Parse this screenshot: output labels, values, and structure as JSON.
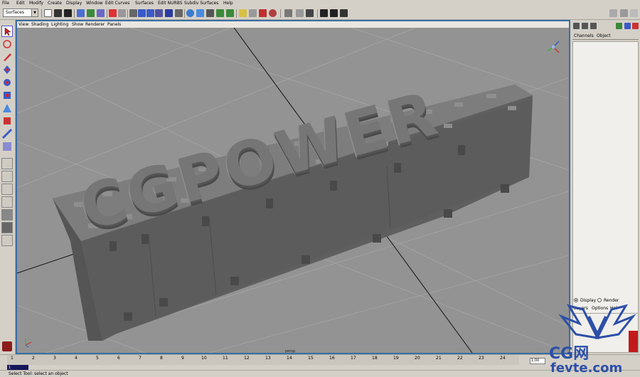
{
  "menu": [
    "File",
    "Edit",
    "Modify",
    "Create",
    "Display",
    "Window",
    "Edit Curves",
    "Surfaces",
    "Edit NURBS",
    "Subdiv Surfaces",
    "Help"
  ],
  "toolbar": {
    "mode": "Surfaces"
  },
  "viewport": {
    "menu": [
      "View",
      "Shading",
      "Lighting",
      "Show",
      "Renderer",
      "Panels"
    ],
    "camera_label": "persp",
    "model_text": "CGPOWER"
  },
  "channel_box": {
    "tabs": [
      "Channels",
      "Object"
    ],
    "layer_modes": [
      "Display",
      "Render"
    ],
    "layer_mode_selected": "Display",
    "layer_menu": [
      "Layers",
      "Options",
      "Hel"
    ]
  },
  "timeline": {
    "ticks": [
      "1",
      "2",
      "3",
      "4",
      "5",
      "6",
      "7",
      "8",
      "9",
      "10",
      "11",
      "12",
      "13",
      "14",
      "15",
      "16",
      "17",
      "18",
      "19",
      "20",
      "21",
      "22",
      "23",
      "24"
    ],
    "current_frame": "1",
    "range_value": "1.00"
  },
  "help_line": "Select Tool: select an object",
  "watermark": {
    "line1": "CG网",
    "line2": "fevte.com"
  },
  "colors": {
    "viewport_bg": "#939393",
    "ui_bg": "#d4d0c8",
    "active_border": "#3a6ea5",
    "watermark": "#2d4fa8"
  }
}
